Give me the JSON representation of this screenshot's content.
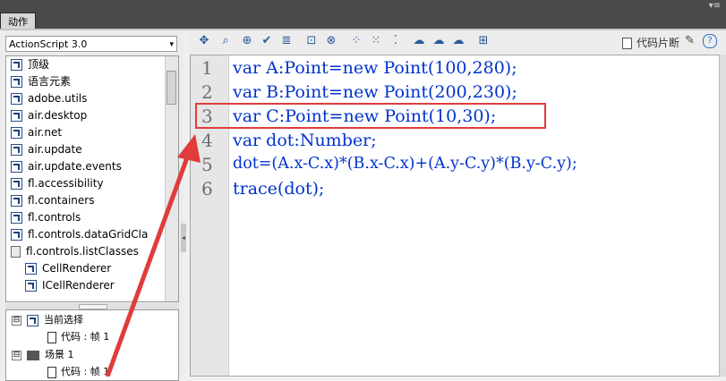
{
  "panel": {
    "tab_label": "动作",
    "menu_glyph": "▾≡"
  },
  "language_select": {
    "value": "ActionScript 3.0",
    "arrow": "▾"
  },
  "toolbox": {
    "items": [
      {
        "label": "顶级",
        "kind": "package"
      },
      {
        "label": "语言元素",
        "kind": "package"
      },
      {
        "label": "adobe.utils",
        "kind": "package"
      },
      {
        "label": "air.desktop",
        "kind": "package"
      },
      {
        "label": "air.net",
        "kind": "package"
      },
      {
        "label": "air.update",
        "kind": "package"
      },
      {
        "label": "air.update.events",
        "kind": "package"
      },
      {
        "label": "fl.accessibility",
        "kind": "package"
      },
      {
        "label": "fl.containers",
        "kind": "package"
      },
      {
        "label": "fl.controls",
        "kind": "package"
      },
      {
        "label": "fl.controls.dataGridCla",
        "kind": "package"
      },
      {
        "label": "fl.controls.listClasses",
        "kind": "book"
      },
      {
        "label": "CellRenderer",
        "kind": "class"
      },
      {
        "label": "ICellRenderer",
        "kind": "class"
      }
    ]
  },
  "script_navigator": {
    "items": [
      {
        "expander": "⊟",
        "label": "当前选择",
        "kind": "selection"
      },
      {
        "label": "代码 : 帧 1",
        "kind": "frame"
      },
      {
        "expander": "⊟",
        "label": "场景 1",
        "kind": "scene"
      },
      {
        "label": "代码 : 帧 1",
        "kind": "frame"
      }
    ]
  },
  "toolbar": {
    "buttons": [
      "✥",
      "⌕",
      "⊕",
      "✔",
      "≣",
      "⊡",
      "⊗",
      "⁘",
      "⁙",
      "⁚",
      "☁",
      "☁",
      "☁",
      "⊞"
    ],
    "snippet_label": "代码片断",
    "wand": "✎",
    "help": "?"
  },
  "editor": {
    "line_numbers": [
      "1",
      "2",
      "3",
      "4",
      "5",
      "6"
    ],
    "lines": [
      "var A:Point=new Point(100,280);",
      "var B:Point=new Point(200,230);",
      "var C:Point=new Point(10,30);",
      "var dot:Number;",
      "dot=(A.x-C.x)*(B.x-C.x)+(A.y-C.y)*(B.y-C.y);",
      "trace(dot);"
    ]
  },
  "colors": {
    "keyword": "#0033cc",
    "annotation": "#e03c3c"
  }
}
